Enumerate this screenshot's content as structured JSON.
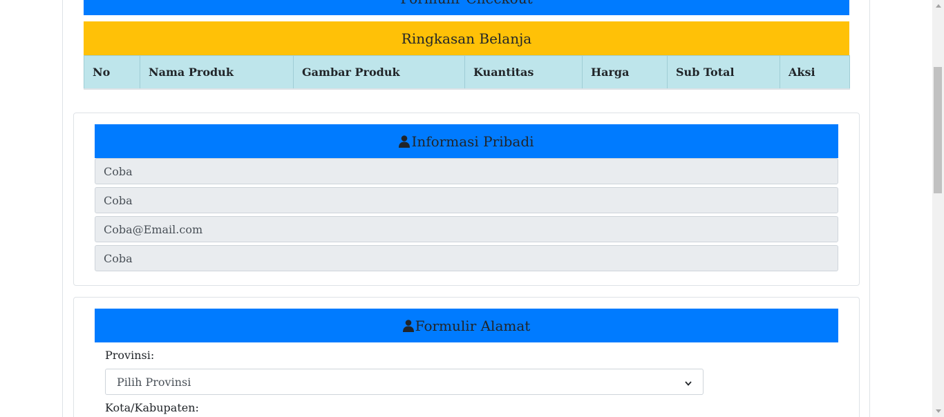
{
  "checkout_banner": {
    "title": "Formulir Checkout"
  },
  "summary": {
    "title": "Ringkasan Belanja",
    "columns": [
      "No",
      "Nama Produk",
      "Gambar Produk",
      "Kuantitas",
      "Harga",
      "Sub Total",
      "Aksi"
    ]
  },
  "personal_info": {
    "title": "Informasi Pribadi",
    "icon": "user-icon",
    "fields": [
      "Coba",
      "Coba",
      "Coba@Email.com",
      "Coba"
    ]
  },
  "address_form": {
    "title": "Formulir Alamat",
    "icon": "user-icon",
    "province_label": "Provinsi:",
    "province_select": "Pilih Provinsi",
    "city_label": "Kota/Kabupaten:"
  },
  "colors": {
    "primary": "#007bff",
    "warning": "#ffc107",
    "info_light": "#bee5eb",
    "readonly_field": "#e9ecef"
  }
}
